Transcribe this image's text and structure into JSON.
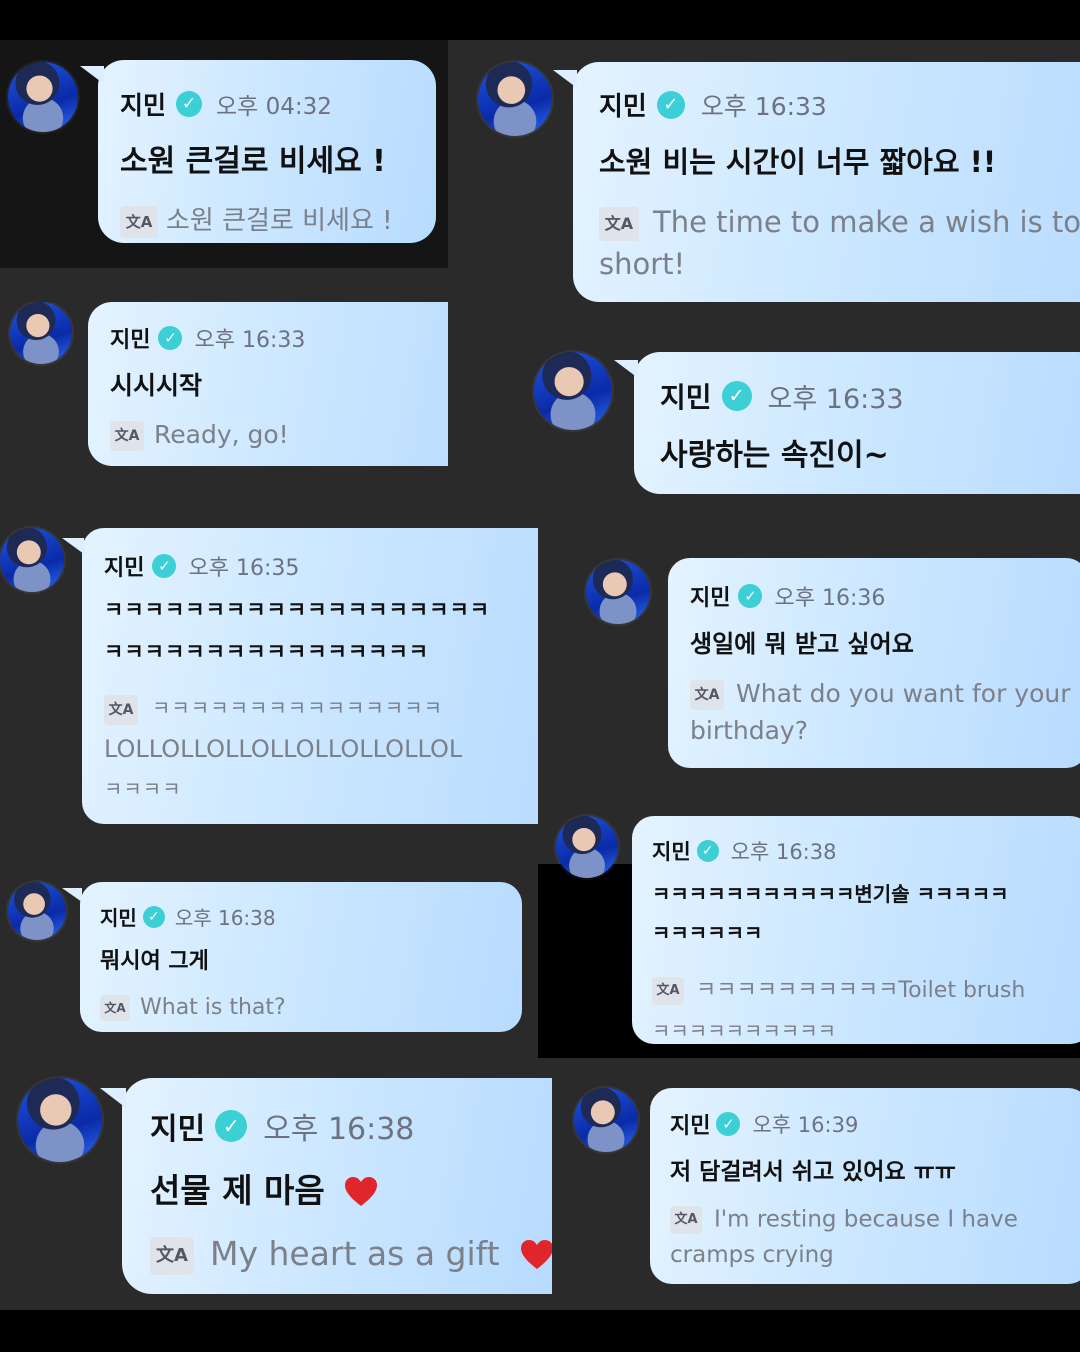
{
  "messages": [
    {
      "sender": "지민",
      "verified_icon": "verified-check-icon",
      "time": "오후 04:32",
      "text": "소원 큰걸로 비세요 !",
      "translation": "소원 큰걸로 비세요 !"
    },
    {
      "sender": "지민",
      "verified_icon": "verified-check-icon",
      "time": "오후 16:33",
      "text": "소원 비는 시간이 너무 짧아요 !!",
      "translation_line1": "The time to make a wish is too",
      "translation_line2": "short!"
    },
    {
      "sender": "지민",
      "verified_icon": "verified-check-icon",
      "time": "오후 16:33",
      "text": "시시시작",
      "translation": "Ready, go!"
    },
    {
      "sender": "지민",
      "verified_icon": "verified-check-icon",
      "time": "오후 16:33",
      "text": "사랑하는 속진이~"
    },
    {
      "sender": "지민",
      "verified_icon": "verified-check-icon",
      "time": "오후 16:35",
      "text_line1": "ㅋㅋㅋㅋㅋㅋㅋㅋㅋㅋㅋㅋㅋㅋㅋㅋㅋㅋㅋ",
      "text_line2": "ㅋㅋㅋㅋㅋㅋㅋㅋㅋㅋㅋㅋㅋㅋㅋㅋ",
      "translation_line1": "ㅋㅋㅋㅋㅋㅋㅋㅋㅋㅋㅋㅋㅋㅋㅋ",
      "translation_line2": "LOLLOLLOLLOLLOLLOLLOLLOL",
      "translation_line3": "ㅋㅋㅋㅋ"
    },
    {
      "sender": "지민",
      "verified_icon": "verified-check-icon",
      "time": "오후 16:36",
      "text": "생일에 뭐 받고 싶어요",
      "translation_line1": "What do you want for your",
      "translation_line2": "birthday?"
    },
    {
      "sender": "지민",
      "verified_icon": "verified-check-icon",
      "time": "오후 16:38",
      "text": "뭐시여 그게",
      "translation": "What is that?"
    },
    {
      "sender": "지민",
      "verified_icon": "verified-check-icon",
      "time": "오후 16:38",
      "text_line1": "ㅋㅋㅋㅋㅋㅋㅋㅋㅋㅋㅋ변기솔 ㅋㅋㅋㅋㅋ",
      "text_line2": "ㅋㅋㅋㅋㅋㅋ",
      "translation_line1": "ㅋㅋㅋㅋㅋㅋㅋㅋㅋㅋToilet brush",
      "translation_line2": "ㅋㅋㅋㅋㅋㅋㅋㅋㅋㅋ"
    },
    {
      "sender": "지민",
      "verified_icon": "verified-check-icon",
      "time": "오후 16:38",
      "text": "선물 제 마음",
      "emoji": "❤️",
      "translation": "My heart as a gift"
    },
    {
      "sender": "지민",
      "verified_icon": "verified-check-icon",
      "time": "오후 16:39",
      "text": "저 담걸려서 쉬고 있어요 ㅠㅠ",
      "translation_line1": "I'm resting because I have",
      "translation_line2": "cramps crying"
    }
  ],
  "ui": {
    "translate_icon_label": "文A",
    "verified_mark": "✓",
    "heart_color": "#e0252b",
    "badge_color": "#3ccfd6",
    "bubble_color": "#cde8ff"
  }
}
